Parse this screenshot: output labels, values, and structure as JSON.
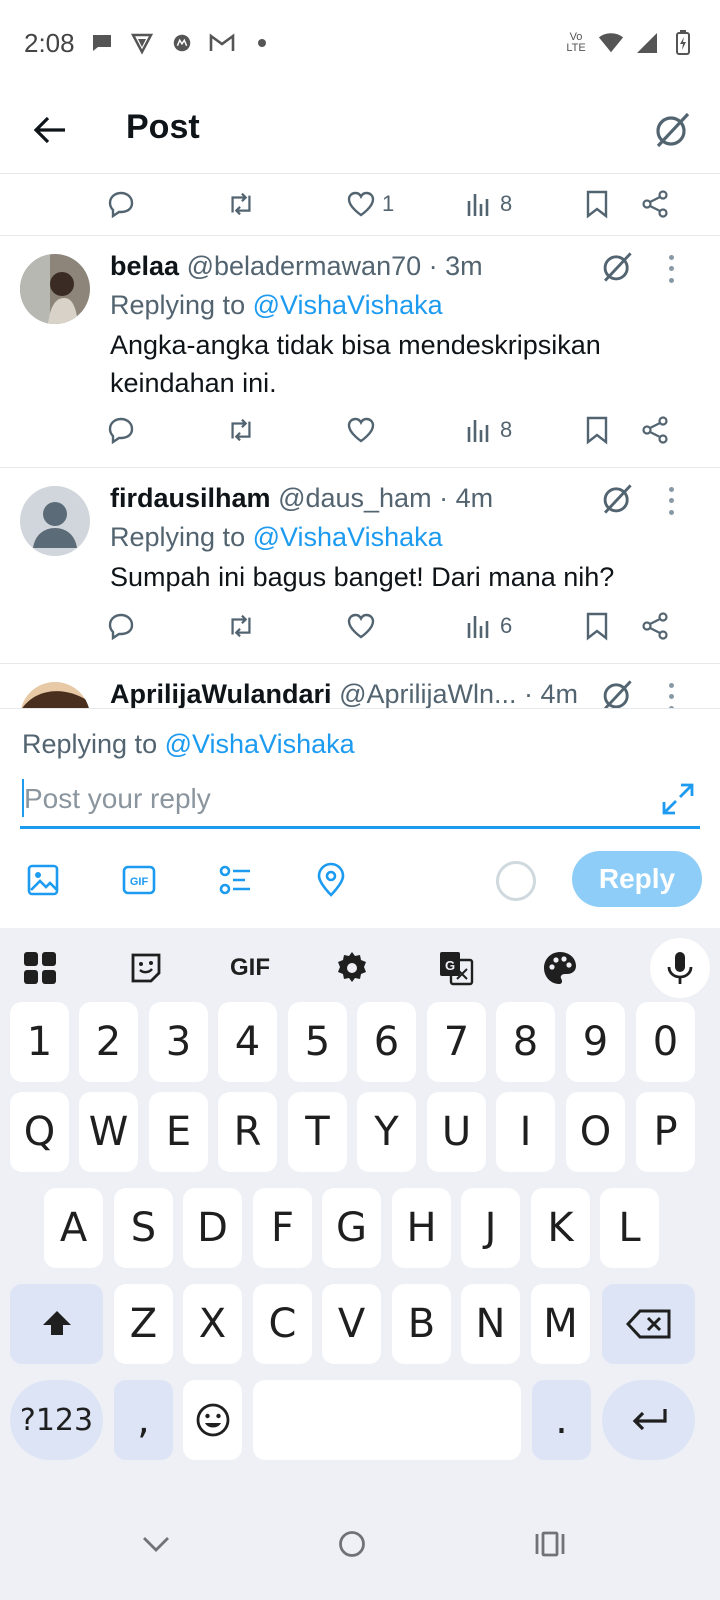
{
  "status_bar": {
    "time": "2:08",
    "network_label": "Vo LTE"
  },
  "header": {
    "title": "Post"
  },
  "top_actions": {
    "likes": "1",
    "views": "8"
  },
  "tweets": [
    {
      "name": "belaa",
      "handle": "@beladermawan70",
      "time": "· 3m",
      "replying_prefix": "Replying to ",
      "replying_to": "@VishaVishaka",
      "text": "Angka-angka tidak bisa mendeskripsikan keindahan ini.",
      "views": "8"
    },
    {
      "name": "firdausilham",
      "handle": "@daus_ham",
      "time": "· 4m",
      "replying_prefix": "Replying to ",
      "replying_to": "@VishaVishaka",
      "text": "Sumpah ini bagus banget! Dari mana nih?",
      "views": "6"
    },
    {
      "name": "AprilijaWulandari",
      "handle": "@AprilijaWln...",
      "time": "· 4m"
    }
  ],
  "composer": {
    "replying_prefix": "Replying to ",
    "replying_to": "@VishaVishaka",
    "placeholder": "Post your reply",
    "reply_label": "Reply",
    "gif_label": "GIF"
  },
  "keyboard": {
    "gif_label": "GIF",
    "row_numbers": [
      "1",
      "2",
      "3",
      "4",
      "5",
      "6",
      "7",
      "8",
      "9",
      "0"
    ],
    "row_1": [
      "Q",
      "W",
      "E",
      "R",
      "T",
      "Y",
      "U",
      "I",
      "O",
      "P"
    ],
    "row_2": [
      "A",
      "S",
      "D",
      "F",
      "G",
      "H",
      "J",
      "K",
      "L"
    ],
    "row_3": [
      "Z",
      "X",
      "C",
      "V",
      "B",
      "N",
      "M"
    ],
    "symbols_label": "?123",
    "comma_label": ",",
    "period_label": "."
  },
  "colors": {
    "accent": "#1d9bf0",
    "reply_button": "#8ecdf7",
    "keyboard_bg": "#eef0f6",
    "function_key": "#dce4f5"
  }
}
